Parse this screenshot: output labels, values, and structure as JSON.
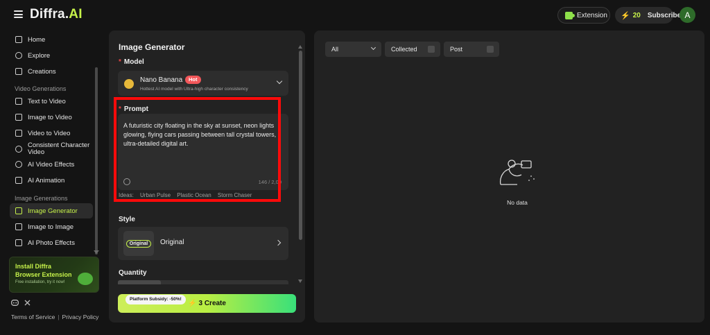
{
  "header": {
    "logo_main": "Diffra.",
    "logo_ai": "AI",
    "extension_label": "Extension",
    "credits": "20",
    "subscribe_label": "Subscribe",
    "avatar_letter": "A"
  },
  "sidebar": {
    "top_items": [
      {
        "label": "Home",
        "icon": "home-icon"
      },
      {
        "label": "Explore",
        "icon": "compass-icon"
      },
      {
        "label": "Creations",
        "icon": "grid-icon"
      }
    ],
    "video_section_label": "Video Generations",
    "video_items": [
      {
        "label": "Text to Video"
      },
      {
        "label": "Image to Video"
      },
      {
        "label": "Video to Video"
      },
      {
        "label": "Consistent Character Video"
      },
      {
        "label": "AI Video Effects"
      },
      {
        "label": "AI Animation"
      }
    ],
    "image_section_label": "Image Generations",
    "image_items": [
      {
        "label": "Image Generator",
        "active": true
      },
      {
        "label": "Image to Image"
      },
      {
        "label": "AI Photo Effects"
      }
    ],
    "promo": {
      "title": "Install Diffra Browser Extension",
      "subtitle": "Free installation, try it now!"
    },
    "social": {
      "discord": "discord-icon",
      "x": "x-icon"
    },
    "footer": {
      "terms": "Terms of Service",
      "privacy": "Privacy Policy"
    }
  },
  "generator": {
    "title": "Image Generator",
    "model_label": "Model",
    "model": {
      "name": "Nano Banana",
      "badge": "Hot",
      "description": "Hottest AI model with Ultra-high character consistency"
    },
    "prompt_label": "Prompt",
    "prompt_text": "A futuristic city floating in the sky at sunset, neon lights glowing, flying cars passing between tall crystal towers, ultra-detailed digital art.",
    "char_count": "146 / 2,00",
    "ideas_label": "Ideas:",
    "ideas": [
      "Urban Pulse",
      "Plastic Ocean",
      "Storm Chaser"
    ],
    "style_label": "Style",
    "style": {
      "thumb_label": "Original",
      "name": "Original"
    },
    "quantity_label": "Quantity",
    "create_label": "3 Create",
    "subsidy_label": "Platform Subsidy: -50%!"
  },
  "results": {
    "filter_all": "All",
    "filter_collected": "Collected",
    "filter_post": "Post",
    "empty_text": "No data"
  },
  "colors": {
    "accent": "#c6f24a",
    "highlight": "#ff0a0a",
    "hot_badge": "#f2575a"
  }
}
